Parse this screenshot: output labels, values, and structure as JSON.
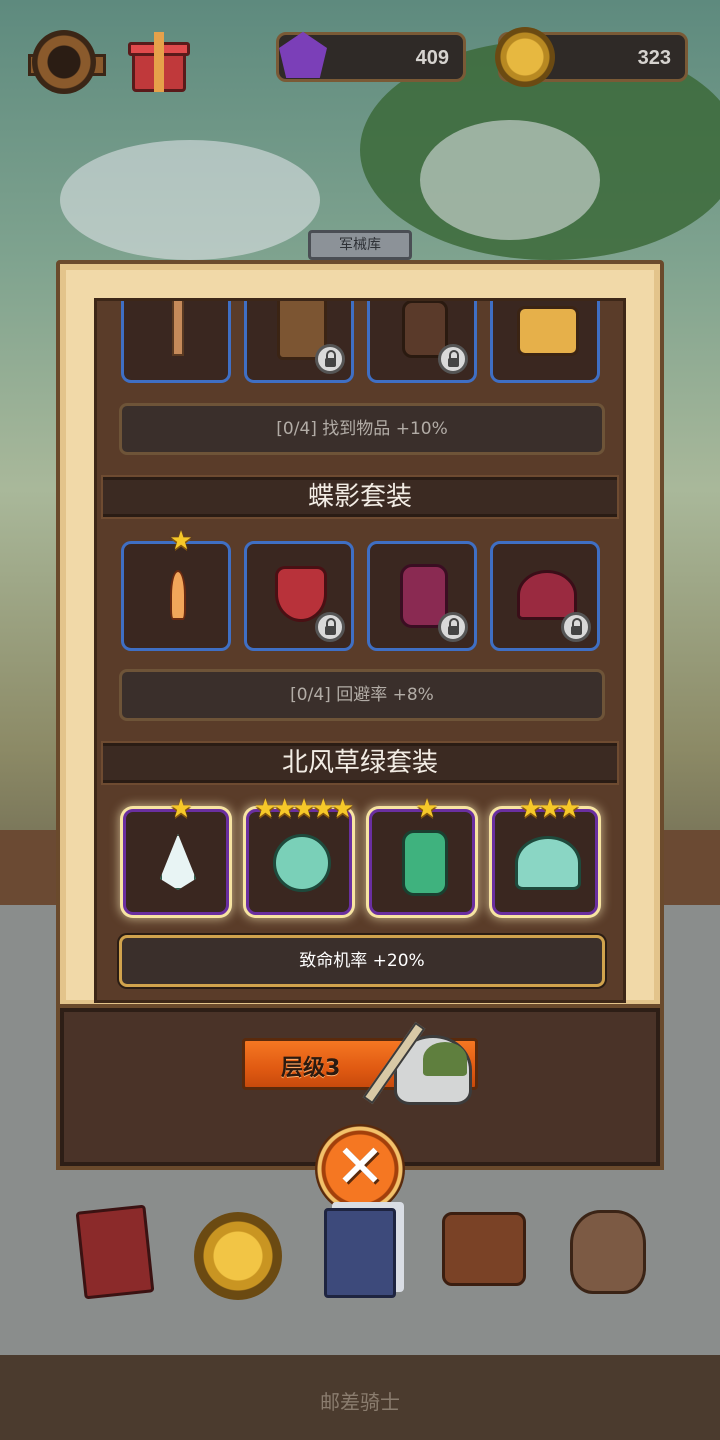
{
  "currencies": {
    "gems": "409",
    "coins": "323"
  },
  "panel": {
    "title": "军械库"
  },
  "sets": [
    {
      "name": "",
      "bonus": "[0/4] 找到物品 +10%",
      "active": false,
      "items": [
        {
          "icon": "sword-item-icon",
          "stars": "",
          "locked": false
        },
        {
          "icon": "shield-item-icon",
          "stars": "",
          "locked": true
        },
        {
          "icon": "armor-item-icon",
          "stars": "",
          "locked": true
        },
        {
          "icon": "helmet-item-icon",
          "stars": "",
          "locked": false
        }
      ]
    },
    {
      "name": "蝶影套装",
      "bonus": "[0/4] 回避率 +8%",
      "active": false,
      "items": [
        {
          "icon": "dagger-item-icon",
          "stars": "★",
          "locked": false
        },
        {
          "icon": "shield-item-icon",
          "stars": "",
          "locked": true
        },
        {
          "icon": "armor-item-icon",
          "stars": "",
          "locked": true
        },
        {
          "icon": "helmet-item-icon",
          "stars": "",
          "locked": true
        }
      ]
    },
    {
      "name": "北风草绿套装",
      "bonus": "致命机率 +20%",
      "active": true,
      "items": [
        {
          "icon": "crystal-blade-item-icon",
          "stars": "★",
          "locked": false
        },
        {
          "icon": "winged-shield-item-icon",
          "stars": "★★★★★",
          "locked": false
        },
        {
          "icon": "armor-item-icon",
          "stars": "★",
          "locked": false
        },
        {
          "icon": "helmet-item-icon",
          "stars": "★★★",
          "locked": false
        }
      ]
    }
  ],
  "tier": {
    "label": "层级3"
  },
  "bottom_nav": [
    {
      "icon": "spellbook-icon"
    },
    {
      "icon": "star-coin-icon"
    },
    {
      "icon": "cards-icon"
    },
    {
      "icon": "backpack-icon"
    },
    {
      "icon": "loot-sack-icon"
    }
  ],
  "footer": {
    "text": "邮差骑士"
  },
  "colors": {
    "rare_border": "#3f6fc4",
    "epic_border": "#6a2fa0",
    "star": "#f6c829",
    "tier_bar": "#f57722"
  }
}
